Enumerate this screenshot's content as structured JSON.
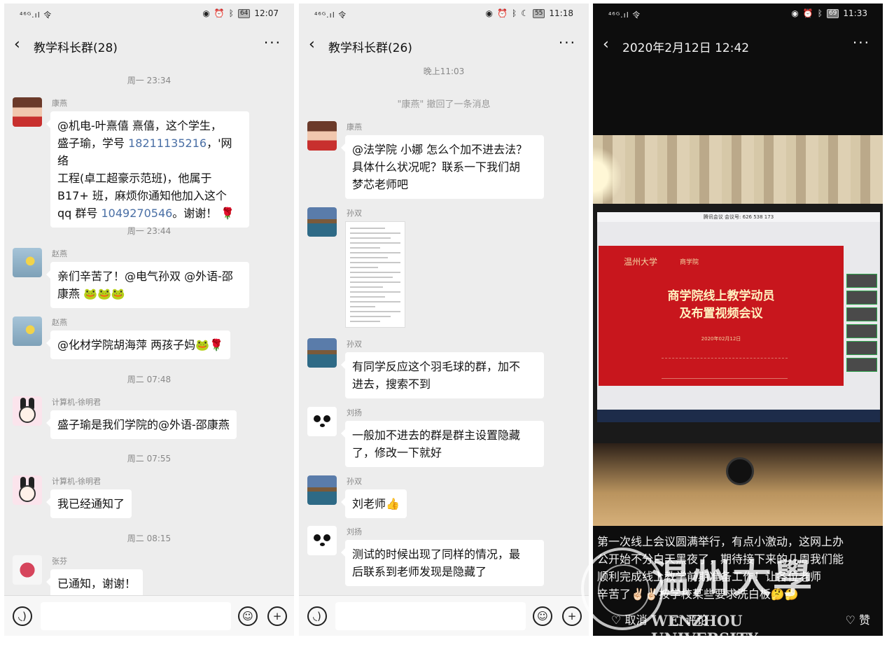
{
  "screen1": {
    "status": {
      "signal": "⁴⁶ᴳ.ıl 令",
      "battery": "64",
      "time": "12:07"
    },
    "title": "教学科长群(28)",
    "times": [
      "周一 23:34",
      "周一 23:44",
      "周二 07:48",
      "周二 07:55",
      "周二 08:15"
    ],
    "messages": [
      {
        "sender": "康燕",
        "lines": [
          "@机电-叶熹僖  熹僖，这个学生，",
          "盛子瑜，学号 18211135216，'网络",
          "工程(卓工超豪示范班)，他属于",
          "B17+ 班，麻烦你通知他加入这个",
          "qq 群号 1049270546。谢谢！ 🌹"
        ]
      },
      {
        "sender": "赵燕",
        "lines": [
          "亲们辛苦了！@电气孙双 @外语-邵",
          "康燕 🐸🐸🐸"
        ]
      },
      {
        "sender": "赵燕",
        "lines": [
          "@化材学院胡海萍  两孩子妈🐸🌹"
        ]
      },
      {
        "sender": "计算机-徐明君",
        "lines": [
          "盛子瑜是我们学院的@外语-邵康燕"
        ]
      },
      {
        "sender": "计算机-徐明君",
        "lines": [
          "我已经通知了"
        ]
      },
      {
        "sender": "张芬",
        "lines": [
          "已通知，谢谢！"
        ]
      }
    ]
  },
  "screen2": {
    "status": {
      "signal": "⁴⁶ᴳ.ıl 令",
      "battery": "55",
      "time": "11:18"
    },
    "title": "教学科长群(26)",
    "time_top": "晚上11:03",
    "recall": "\"康燕\" 撤回了一条消息",
    "messages": [
      {
        "sender": "康燕",
        "lines": [
          "@法学院 小娜 怎么个加不进去法？",
          "具体什么状况呢？联系一下我们胡",
          "梦芯老师吧"
        ]
      },
      {
        "sender": "孙双",
        "lines": []
      },
      {
        "sender": "孙双",
        "lines": [
          "有同学反应这个羽毛球的群，加不",
          "进去，搜索不到"
        ]
      },
      {
        "sender": "刘扬",
        "lines": [
          "一般加不进去的群是群主设置隐藏",
          "了，修改一下就好"
        ]
      },
      {
        "sender": "孙双",
        "lines": [
          "刘老师👍"
        ]
      },
      {
        "sender": "刘扬",
        "lines": [
          "测试的时候出现了同样的情况，最",
          "后联系到老师发现是隐藏了"
        ]
      }
    ]
  },
  "screen3": {
    "status": {
      "signal": "⁴⁶ᴳ.ıl 令",
      "battery": "69",
      "time": "11:33"
    },
    "title": "2020年2月12日 12:42",
    "meeting_bar": "腾讯会议 会议号: 626 538 173",
    "slide": {
      "university": "温州大学",
      "dept": "商学院",
      "title_lines": [
        "商学院线上教学动员",
        "及布置视频会议"
      ],
      "date": "2020年02月12日"
    },
    "caption_lines": [
      "第一次线上会议圆满举行，有点小激动，这网上办",
      "公开始不分白天黑夜了，期待接下来的几周我们能",
      "顺利完成线上教学前期准备工作！让各位老师",
      "辛苦了✌🏻✌🏻按学校某些要求洗白板🤔🤔"
    ],
    "actions": {
      "cancel": "取消",
      "comment": "评论",
      "like": "赞"
    },
    "watermark": {
      "zh": "温州大學",
      "en": "WENZHOU UNIVERSITY"
    }
  }
}
